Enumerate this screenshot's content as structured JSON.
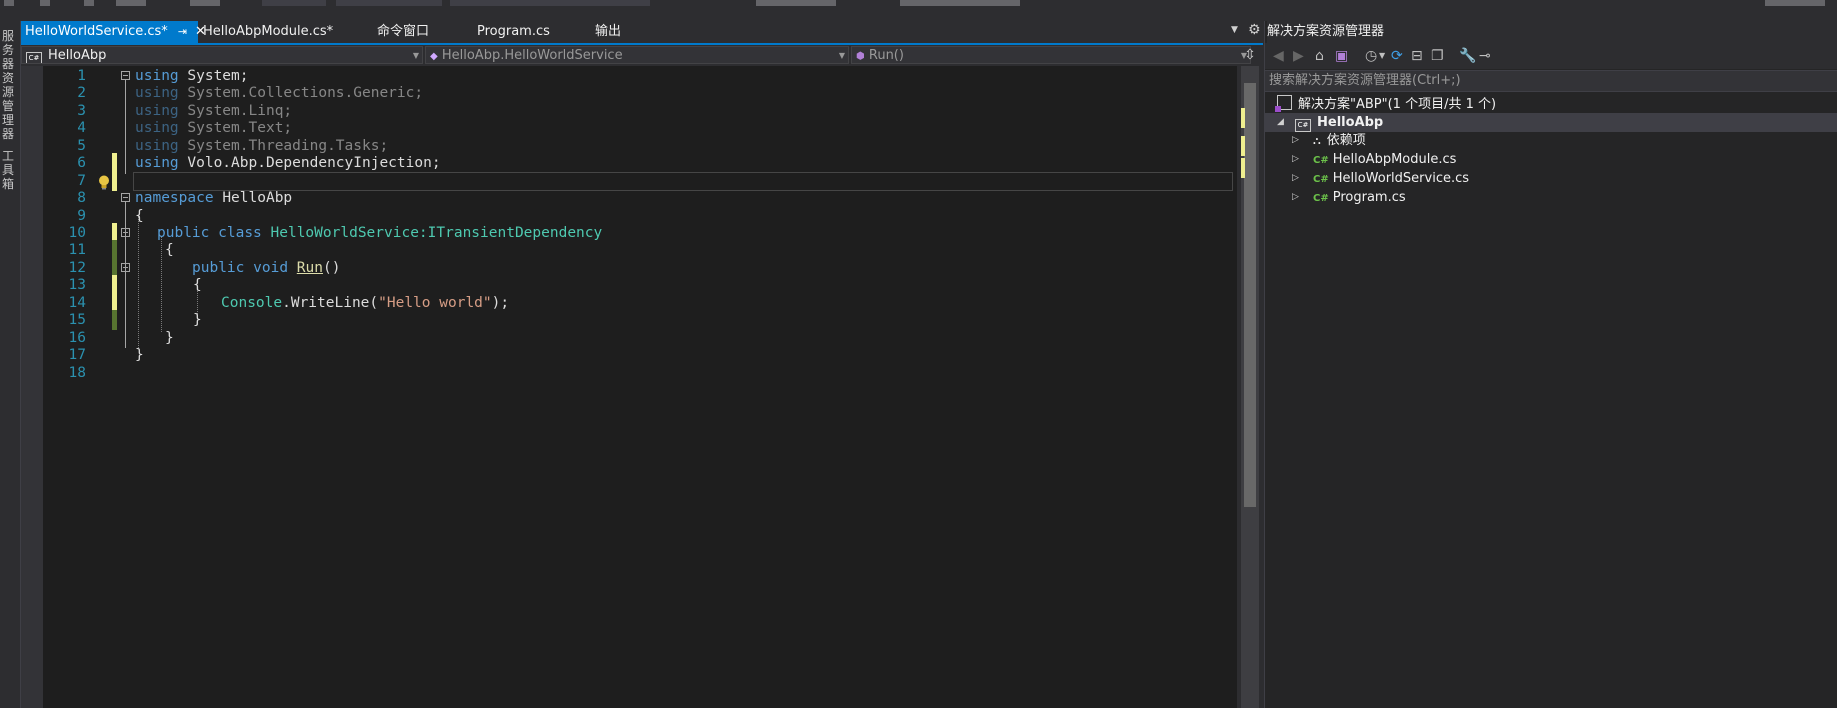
{
  "tabs": [
    {
      "label": "HelloWorldService.cs*",
      "active": true,
      "pin": "⇥",
      "close": "✕"
    },
    {
      "label": "HelloAbpModule.cs*"
    },
    {
      "label": "命令窗口"
    },
    {
      "label": "Program.cs"
    },
    {
      "label": "输出"
    }
  ],
  "side_strip": {
    "item1": "服务器资源管理器",
    "item2": "工具箱"
  },
  "nav": {
    "project": "HelloAbp",
    "class": "HelloAbp.HelloWorldService",
    "member": "Run()"
  },
  "editor": {
    "line_numbers": [
      "1",
      "2",
      "3",
      "4",
      "5",
      "6",
      "7",
      "8",
      "9",
      "10",
      "11",
      "12",
      "13",
      "14",
      "15",
      "16",
      "17",
      "18"
    ],
    "tokens": {
      "using": "using",
      "namespace": "namespace",
      "public": "public",
      "class": "class",
      "void": "void",
      "System": "System;",
      "SystemCollections": "System.Collections.Generic;",
      "SystemLinq": "System.Linq;",
      "SystemText": "System.Text;",
      "SystemThreading": "System.Threading.Tasks;",
      "Volo": "Volo.Abp.DependencyInjection;",
      "ns_name": "HelloAbp",
      "brace_open": "{",
      "brace_close": "}",
      "class_name": "HelloWorldService",
      "base": ":ITransientDependency",
      "method": "Run",
      "parens": "()",
      "console": "Console",
      "writeline": ".WriteLine(",
      "string": "\"Hello world\"",
      "end_call": ");"
    }
  },
  "solution_explorer": {
    "title": "解决方案资源管理器",
    "search_placeholder": "搜索解决方案资源管理器(Ctrl+;)",
    "solution": "解决方案\"ABP\"(1 个项目/共 1 个)",
    "project": "HelloAbp",
    "items": [
      "依赖项",
      "HelloAbpModule.cs",
      "HelloWorldService.cs",
      "Program.cs"
    ]
  },
  "icons": {
    "close": "close-icon",
    "pin": "pin-icon",
    "lightbulb": "lightbulb-icon",
    "cs_file": "csharp-file-icon"
  },
  "colors": {
    "accent": "#007acc",
    "keyword": "#569cd6",
    "type": "#4ec9b0",
    "string": "#d69d85",
    "line_number": "#2b91af"
  }
}
